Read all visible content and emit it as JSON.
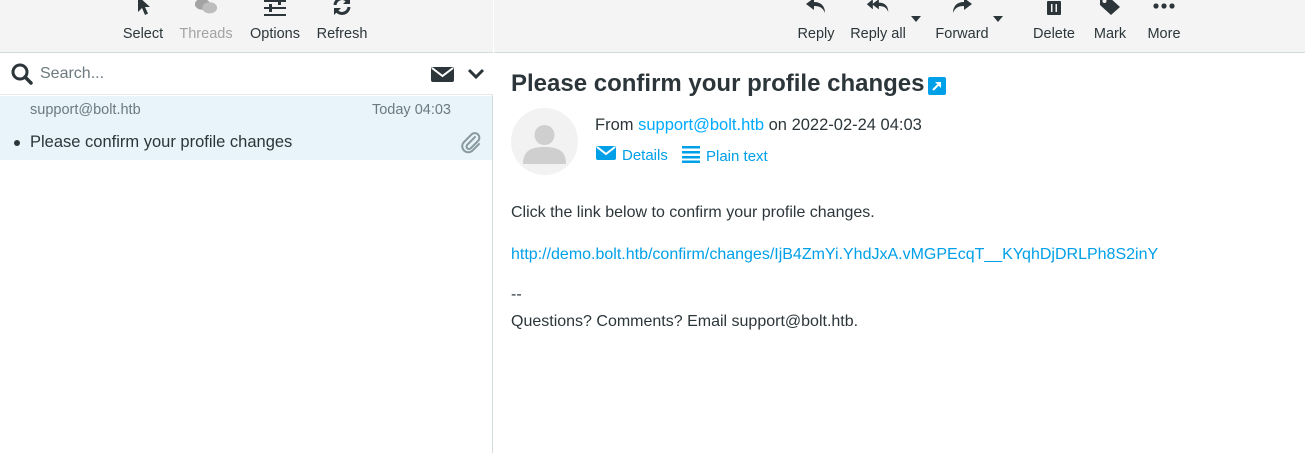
{
  "left_toolbar": {
    "select": "Select",
    "threads": "Threads",
    "options": "Options",
    "refresh": "Refresh"
  },
  "search": {
    "placeholder": "Search...",
    "value": ""
  },
  "message_list": [
    {
      "from": "support@bolt.htb",
      "date": "Today 04:03",
      "subject": "Please confirm your profile changes",
      "has_attachment": true,
      "unread": true
    }
  ],
  "right_toolbar": {
    "reply": "Reply",
    "reply_all": "Reply all",
    "forward": "Forward",
    "delete": "Delete",
    "mark": "Mark",
    "more": "More"
  },
  "mail": {
    "subject": "Please confirm your profile changes",
    "from_prefix": "From",
    "from_address": "support@bolt.htb",
    "on_word": "on",
    "date": "2022-02-24 04:03",
    "details_label": "Details",
    "plain_text_label": "Plain text",
    "body_line1": "Click the link below to confirm your profile changes.",
    "link": "http://demo.bolt.htb/confirm/changes/IjB4ZmYi.YhdJxA.vMGPEcqT__KYqhDjDRLPh8S2inY",
    "signature_sep": "--",
    "signature": "Questions? Comments? Email support@bolt.htb."
  },
  "colors": {
    "accent": "#00a0e8",
    "selected_row": "#e8f4fa",
    "toolbar_bg": "#f4f4f4",
    "text": "#2c363a"
  },
  "icons": [
    "cursor-icon",
    "threads-icon",
    "options-icon",
    "refresh-icon",
    "search-icon",
    "envelope-icon",
    "chevron-down-icon",
    "paperclip-icon",
    "reply-icon",
    "reply-all-icon",
    "forward-icon",
    "trash-icon",
    "tag-icon",
    "ellipsis-icon",
    "popout-icon",
    "avatar-icon",
    "details-envelope-icon",
    "plain-text-icon"
  ]
}
